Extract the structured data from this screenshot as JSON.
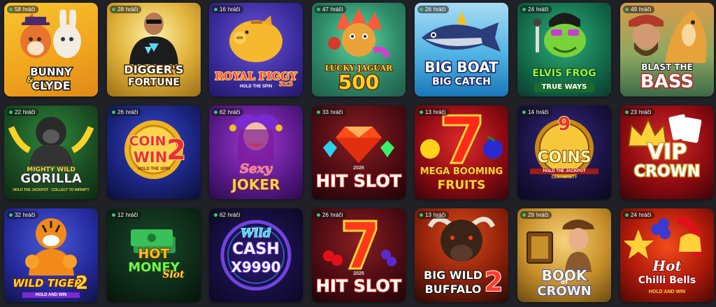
{
  "badge_suffix": "hráči",
  "games": [
    {
      "title": "BUNNY",
      "title2": "CLYDE",
      "amp": "&",
      "players": "58"
    },
    {
      "title": "DIGGER'S",
      "title2": "FORTUNE",
      "players": "28"
    },
    {
      "title": "ROYAL PIGGY",
      "title2": "3x3",
      "sub": "HOLD THE SPIN",
      "players": "16"
    },
    {
      "title": "LUCKY JAGUAR",
      "title2": "500",
      "players": "47"
    },
    {
      "title": "BIG BOAT",
      "title2": "BIG CATCH",
      "players": "26"
    },
    {
      "title": "ELVIS FROG",
      "title2": "TRUE WAYS",
      "players": "24"
    },
    {
      "title": "BLAST THE",
      "title2": "BASS",
      "players": "49"
    },
    {
      "title": "MIGHTY WILD",
      "title2": "GORILLA",
      "sub": "HOLD THE JACKPOT · COLLECT TO INFINITY",
      "players": "22"
    },
    {
      "title": "COIN",
      "title2": "WIN",
      "num": "2",
      "sub": "HOLD THE SPIN",
      "players": "26"
    },
    {
      "title": "Sexy",
      "title2": "JOKER",
      "players": "62"
    },
    {
      "title": "HIT SLOT",
      "year": "2026",
      "players": "33"
    },
    {
      "title": "MEGA BOOMING",
      "title2": "FRUITS",
      "players": "13"
    },
    {
      "title": "COINS",
      "num": "9",
      "sub": "HOLD THE JACKPOT",
      "sub2": "CASH INFINITY",
      "players": "14"
    },
    {
      "title": "VIP",
      "title2": "CROWN",
      "players": "23"
    },
    {
      "title": "WILD TIGER",
      "num": "2",
      "sub": "HOLD AND WIN",
      "players": "32"
    },
    {
      "title": "HOT",
      "title2": "MONEY",
      "title3": "Slot",
      "players": "12"
    },
    {
      "title": "Wild",
      "title2": "CASH",
      "title3": "X9990",
      "players": "62"
    },
    {
      "title": "HIT SLOT",
      "year": "2025",
      "players": "26"
    },
    {
      "title": "BIG WILD",
      "title2": "BUFFALO",
      "num": "2",
      "players": "13"
    },
    {
      "title": "BOOK",
      "title2": "CROWN",
      "amp": "of",
      "players": "29"
    },
    {
      "title": "Hot",
      "title2": "Chilli Bells",
      "sub": "HOLD AND WIN",
      "players": "24"
    }
  ],
  "colors": {
    "background": "#1f2126",
    "online_dot": "#2ecc71"
  }
}
